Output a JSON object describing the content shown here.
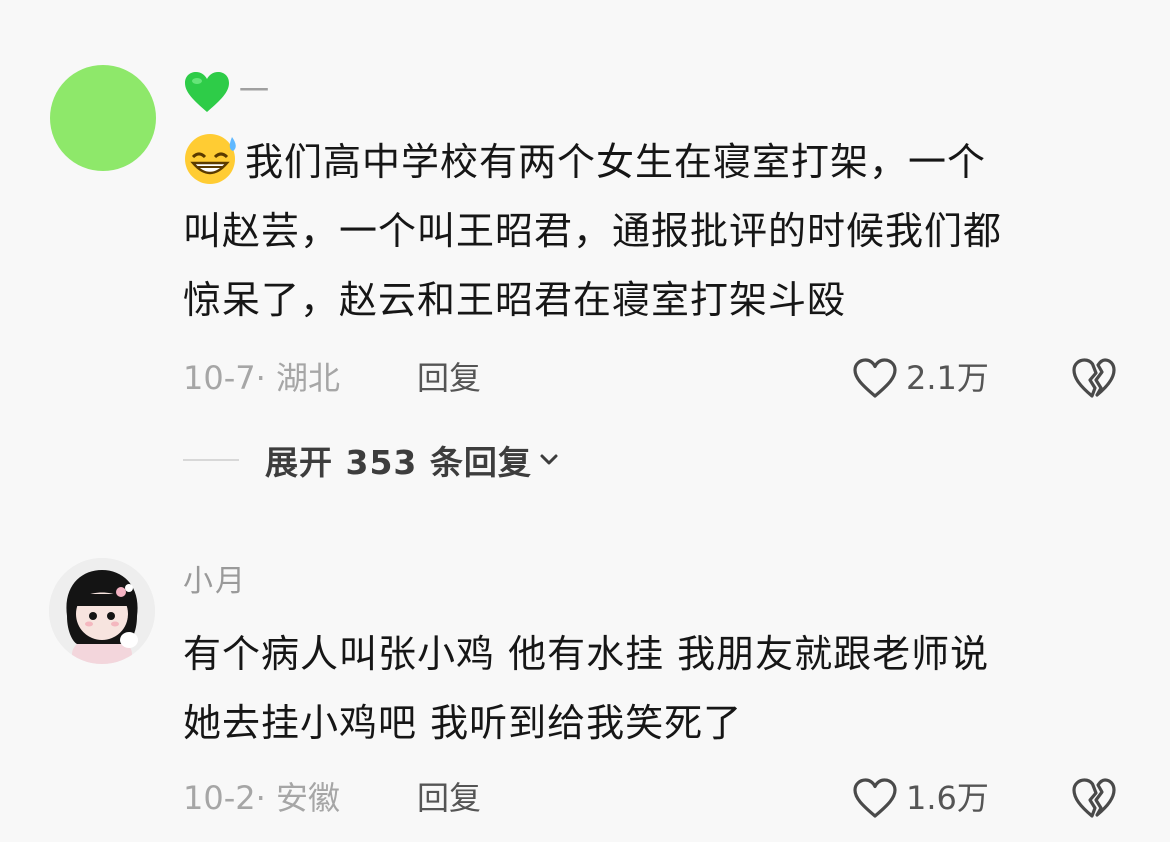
{
  "comments": [
    {
      "username": "一",
      "username_icon": "green-heart-icon",
      "text_icon": "grinning-sweat-emoji-icon",
      "lines": [
        "我们高中学校有两个女生在寝室打架，一个",
        "叫赵芸，一个叫王昭君，通报批评的时候我们都",
        "惊呆了，赵云和王昭君在寝室打架斗殴"
      ],
      "meta": "10-7· 湖北",
      "reply_label": "回复",
      "likes": "2.1万",
      "expand_label": "展开 353 条回复"
    },
    {
      "username": "小月",
      "lines": [
        "有个病人叫张小鸡 他有水挂 我朋友就跟老师说",
        "她去挂小鸡吧 我听到给我笑死了"
      ],
      "meta": "10-2· 安徽",
      "reply_label": "回复",
      "likes": "1.6万"
    }
  ],
  "colors": {
    "background": "#f8f8f8",
    "avatar_green": "#8ee86a",
    "heart_green": "#2ecc48"
  }
}
